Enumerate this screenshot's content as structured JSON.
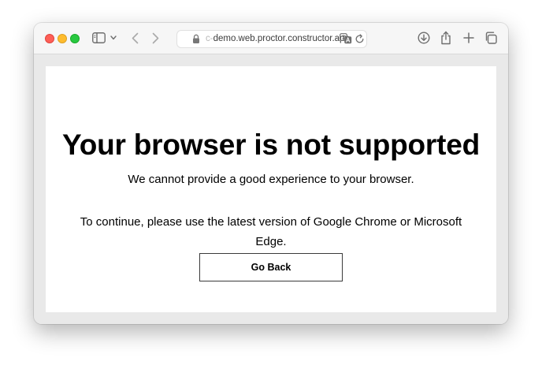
{
  "browser": {
    "url_prefix": "c-",
    "url_main": "demo.web.proctor.constructor.app",
    "icons": {
      "sidebar": "sidebar-icon",
      "sidebar_menu": "chevron-down-icon",
      "back": "chevron-left-icon",
      "forward": "chevron-right-icon",
      "lock": "lock-icon",
      "translate": "translate-icon",
      "reload": "reload-icon",
      "download": "download-icon",
      "share": "share-icon",
      "new_tab": "plus-icon",
      "tab_overview": "tabs-icon"
    },
    "colors": {
      "close": "#fe5f57",
      "minimize": "#febc2e",
      "zoom": "#28c840"
    }
  },
  "page": {
    "title": "Your browser is not supported",
    "subtitle": "We cannot provide a good experience to your browser.",
    "instruction": "To continue, please use the latest version of Google Chrome or Microsoft Edge.",
    "button_label": "Go Back"
  }
}
